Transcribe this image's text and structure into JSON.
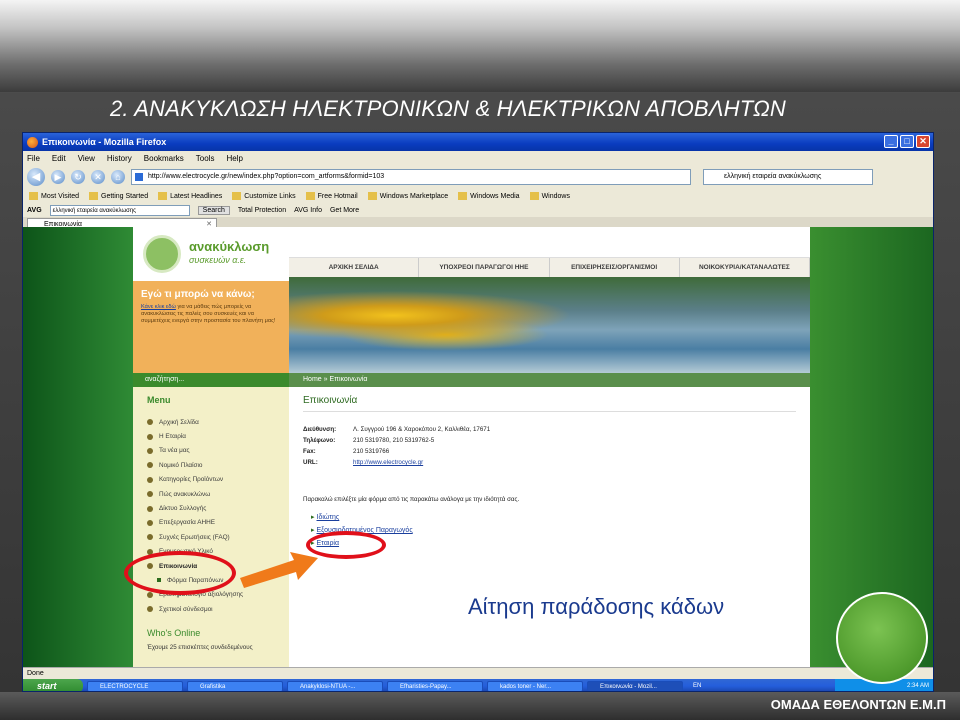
{
  "slide": {
    "title": "2. ΑΝΑΚΥΚΛΩΣΗ ΗΛΕΚΤΡΟΝΙΚΩΝ & ΗΛΕΚΤΡΙΚΩΝ ΑΠΟΒΛΗΤΩΝ",
    "caption": "Αίτηση παράδοσης κάδων",
    "team": "ΟΜΑΔΑ ΕΘΕΛΟΝΤΩΝ Ε.Μ.Π"
  },
  "browser": {
    "window_title": "Επικοινωνία - Mozilla Firefox",
    "menu": [
      "File",
      "Edit",
      "View",
      "History",
      "Bookmarks",
      "Tools",
      "Help"
    ],
    "url": "http://www.electrocycle.gr/new/index.php?option=com_artforms&formid=103",
    "search_value": "ελληνική εταιρεία ανακύκλωσης",
    "bookmarks": [
      "Most Visited",
      "Getting Started",
      "Latest Headlines",
      "Customize Links",
      "Free Hotmail",
      "Windows Marketplace",
      "Windows Media",
      "Windows"
    ],
    "avg_toolbar": {
      "label": "AVG",
      "search_value": "ελληνική εταιρεία ανακύκλωσης",
      "search_button": "Search",
      "items": [
        "Total Protection",
        "AVG Info",
        "Get More"
      ]
    },
    "tab_label": "Επικοινωνία",
    "status": "Done"
  },
  "site": {
    "logo_main": "ανακύκλωση",
    "logo_sub": "συσκευών α.ε.",
    "nav": [
      "ΑΡΧΙΚΗ ΣΕΛΙΔΑ",
      "ΥΠΟΧΡΕΟΙ ΠΑΡΑΓΩΓΟΙ ΗΗΕ",
      "ΕΠΙΧΕΙΡΗΣΕΙΣ/ΟΡΓΑΝΙΣΜΟΙ",
      "ΝΟΙΚΟΚΥΡΙΑ/ΚΑΤΑΝΑΛΩΤΕΣ"
    ],
    "hero_heading": "Εγώ τι μπορώ να κάνω;",
    "hero_link": "Κάνε κλικ εδώ",
    "hero_text": " για να μάθεις πώς μπορείς να ανακυκλώσεις τις παλιές σου συσκευές και να συμμετέχεις ενεργά στην προστασία του πλανήτη μας!",
    "search_label": "αναζήτηση...",
    "breadcrumb": "Home » Επικοινωνία",
    "menu_title": "Menu",
    "menu": [
      {
        "label": "Αρχική Σελίδα",
        "type": "item"
      },
      {
        "label": "Η Εταιρία",
        "type": "item"
      },
      {
        "label": "Τα νέα μας",
        "type": "item"
      },
      {
        "label": "Νομικό Πλαίσιο",
        "type": "item"
      },
      {
        "label": "Κατηγορίες Προϊόντων",
        "type": "item"
      },
      {
        "label": "Πώς ανακυκλώνω",
        "type": "item"
      },
      {
        "label": "Δίκτυο Συλλογής",
        "type": "item"
      },
      {
        "label": "Επεξεργασία ΑΗΗΕ",
        "type": "item"
      },
      {
        "label": "Συχνές Ερωτήσεις (FAQ)",
        "type": "item"
      },
      {
        "label": "Ενημερωτικό Υλικό",
        "type": "item"
      },
      {
        "label": "Επικοινωνία",
        "type": "active"
      },
      {
        "label": "Φόρμα Παραπόνων",
        "type": "sub"
      },
      {
        "label": "Ερωτηματολόγιο αξιολόγησης",
        "type": "item"
      },
      {
        "label": "Σχετικοί σύνδεσμοι",
        "type": "item"
      }
    ],
    "whos_online_title": "Who's Online",
    "whos_online_text": "Έχουμε 25 επισκέπτες συνδεδεμένους",
    "content_title": "Επικοινωνία",
    "contact": [
      {
        "k": "Διεύθυνση:",
        "v": "Λ. Συγγρού 196 & Χαροκόπου 2, Καλλιθέα, 17671"
      },
      {
        "k": "Τηλέφωνο:",
        "v": "210 5319780, 210 5319762-5"
      },
      {
        "k": "Fax:",
        "v": "210 5319766"
      },
      {
        "k": "URL:",
        "v": "http://www.electrocycle.gr"
      }
    ],
    "intro": "Παρακαλώ επιλέξτε μία φόρμα από τις παρακάτω ανάλογα με την ιδιότητά σας.",
    "forms": [
      "Ιδιώτης",
      "Εξουσιοδοτημένος Παραγωγός",
      "Εταιρία"
    ]
  },
  "taskbar": {
    "start": "start",
    "tasks": [
      "ELECTROCYCLE",
      "Grafistika",
      "Anakyklosi-NTUA -...",
      "Efharisties-Papay...",
      "kados toner - Ner...",
      "Επικοινωνία - Mozil..."
    ],
    "lang": "EN",
    "clock": "2:34 AM"
  }
}
